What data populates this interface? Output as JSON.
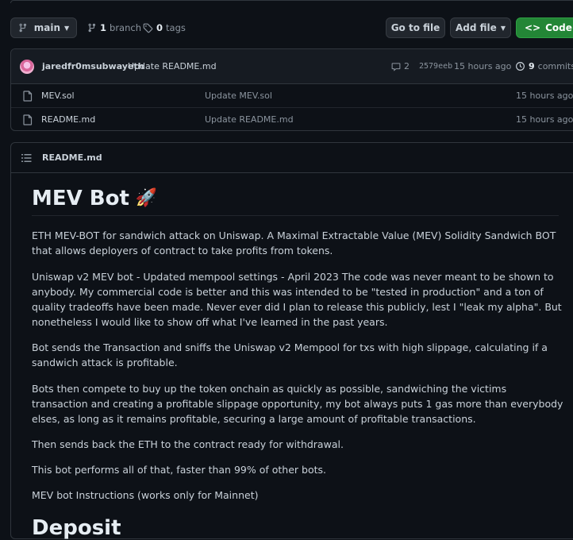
{
  "toolbar": {
    "branch_name": "main",
    "branches_count": "1",
    "branches_label": "branch",
    "tags_count": "0",
    "tags_label": "tags",
    "go_to_file": "Go to file",
    "add_file": "Add file",
    "code": "Code"
  },
  "commit": {
    "author": "jaredfr0msubwayeth",
    "message": "Update README.md",
    "comments": "2",
    "hash": "2579eeb",
    "age": "15 hours ago",
    "commits_count": "9",
    "commits_label": "commits"
  },
  "files": [
    {
      "name": "MEV.sol",
      "message": "Update MEV.sol",
      "age": "15 hours ago"
    },
    {
      "name": "README.md",
      "message": "Update README.md",
      "age": "15 hours ago"
    }
  ],
  "readme": {
    "filename": "README.md",
    "title": "MEV Bot",
    "emoji": "🚀",
    "paragraphs": [
      "ETH MEV-BOT for sandwich attack on Uniswap. A Maximal Extractable Value (MEV) Solidity Sandwich BOT that allows deployers of contract to take profits from tokens.",
      "Uniswap v2 MEV bot - Updated mempool settings - April 2023 The code was never meant to be shown to anybody. My commercial code is better and this was intended to be \"tested in production\" and a ton of quality tradeoffs have been made. Never ever did I plan to release this publicly, lest I \"leak my alpha\". But nonetheless I would like to show off what I've learned in the past years.",
      "Bot sends the Transaction and sniffs the Uniswap v2 Mempool for txs with high slippage, calculating if a sandwich attack is profitable.",
      "Bots then compete to buy up the token onchain as quickly as possible, sandwiching the victims transaction and creating a profitable slippage opportunity, my bot always puts 1 gas more than everybody elses, as long as it remains profitable, securing a large amount of profitable transactions.",
      "Then sends back the ETH to the contract ready for withdrawal.",
      "This bot performs all of that, faster than 99% of other bots.",
      "MEV bot Instructions (works only for Mainnet)"
    ],
    "next_heading": "Deposit"
  },
  "colors": {
    "background": "#0d1117",
    "code_button": "#238636",
    "border": "#30363d"
  }
}
